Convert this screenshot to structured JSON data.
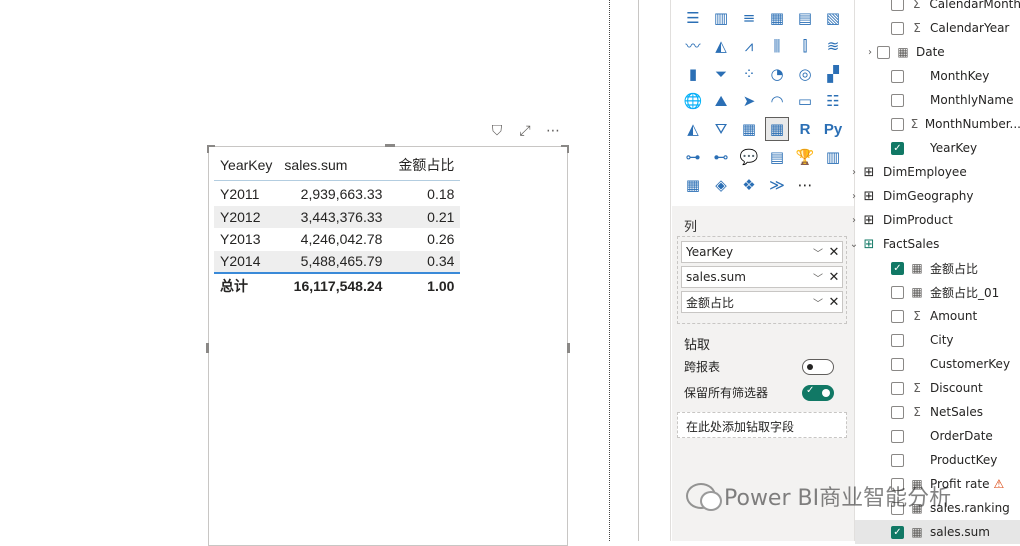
{
  "visual": {
    "header_icons": [
      "filter-icon",
      "focus-mode-icon",
      "more-options-icon"
    ],
    "header_glyphs": {
      "filter": "⛉",
      "focus": "⤢",
      "more": "⋯"
    },
    "table": {
      "headers": [
        "YearKey",
        "sales.sum",
        "金额占比"
      ],
      "rows": [
        [
          "Y2011",
          "2,939,663.33",
          "0.18"
        ],
        [
          "Y2012",
          "3,443,376.33",
          "0.21"
        ],
        [
          "Y2013",
          "4,246,042.78",
          "0.26"
        ],
        [
          "Y2014",
          "5,488,465.79",
          "0.34"
        ]
      ],
      "total": [
        "总计",
        "16,117,548.24",
        "1.00"
      ]
    }
  },
  "viz_pane": {
    "grid_icons": [
      {
        "name": "stacked-bar-chart-icon",
        "glyph": "☰"
      },
      {
        "name": "stacked-column-chart-icon",
        "glyph": "▥"
      },
      {
        "name": "clustered-bar-chart-icon",
        "glyph": "≡"
      },
      {
        "name": "clustered-column-chart-icon",
        "glyph": "▦"
      },
      {
        "name": "100-stacked-bar-chart-icon",
        "glyph": "▤"
      },
      {
        "name": "100-stacked-column-chart-icon",
        "glyph": "▧"
      },
      {
        "name": "line-chart-icon",
        "glyph": "〰"
      },
      {
        "name": "area-chart-icon",
        "glyph": "◭"
      },
      {
        "name": "stacked-area-chart-icon",
        "glyph": "⩘"
      },
      {
        "name": "line-and-column-chart-icon",
        "glyph": "⫼"
      },
      {
        "name": "line-and-clustered-column-icon",
        "glyph": "⫿"
      },
      {
        "name": "ribbon-chart-icon",
        "glyph": "≋"
      },
      {
        "name": "waterfall-chart-icon",
        "glyph": "▮"
      },
      {
        "name": "funnel-chart-icon",
        "glyph": "⏷"
      },
      {
        "name": "scatter-chart-icon",
        "glyph": "⁘"
      },
      {
        "name": "pie-chart-icon",
        "glyph": "◔"
      },
      {
        "name": "donut-chart-icon",
        "glyph": "◎"
      },
      {
        "name": "treemap-icon",
        "glyph": "▞"
      },
      {
        "name": "map-icon",
        "glyph": "🌐"
      },
      {
        "name": "filled-map-icon",
        "glyph": "⛰"
      },
      {
        "name": "azure-map-icon",
        "glyph": "➤"
      },
      {
        "name": "gauge-icon",
        "glyph": "◠"
      },
      {
        "name": "card-icon",
        "glyph": "▭"
      },
      {
        "name": "multi-row-card-icon",
        "glyph": "☷"
      },
      {
        "name": "kpi-icon",
        "glyph": "◭"
      },
      {
        "name": "slicer-icon",
        "glyph": "⛛"
      },
      {
        "name": "table-visual-icon",
        "glyph": "▦"
      },
      {
        "name": "matrix-visual-icon",
        "glyph": "▦"
      },
      {
        "name": "r-script-visual-icon",
        "glyph": "R"
      },
      {
        "name": "python-visual-icon",
        "glyph": "Py"
      },
      {
        "name": "key-influencers-icon",
        "glyph": "⊶"
      },
      {
        "name": "decomposition-tree-icon",
        "glyph": "⊷"
      },
      {
        "name": "qna-icon",
        "glyph": "💬"
      },
      {
        "name": "smart-narrative-icon",
        "glyph": "▤"
      },
      {
        "name": "goals-icon",
        "glyph": "🏆"
      },
      {
        "name": "paginated-report-icon",
        "glyph": "▥"
      },
      {
        "name": "custom-visual-1-icon",
        "glyph": "▦"
      },
      {
        "name": "custom-visual-2-icon",
        "glyph": "◈"
      },
      {
        "name": "custom-visual-3-icon",
        "glyph": "❖"
      },
      {
        "name": "custom-visual-4-icon",
        "glyph": "≫"
      },
      {
        "name": "get-more-visuals-icon",
        "glyph": "⋯"
      }
    ],
    "selected_visual_index": 27,
    "columns_label": "列",
    "wells": [
      "YearKey",
      "sales.sum",
      "金额占比"
    ],
    "drill_title": "钻取",
    "cross_report_label": "跨报表",
    "keep_filters_label": "保留所有筛选器",
    "drill_drop_label": "在此处添加钻取字段"
  },
  "fields_pane": {
    "items": [
      {
        "label": "CalendarMonth",
        "type": "sigma",
        "checked": false,
        "indent": 2
      },
      {
        "label": "CalendarYear",
        "type": "sigma",
        "checked": false,
        "indent": 2
      },
      {
        "label": "Date",
        "type": "calendar",
        "checked": false,
        "indent": 1,
        "expand": "›"
      },
      {
        "label": "MonthKey",
        "type": "none",
        "checked": false,
        "indent": 2
      },
      {
        "label": "MonthlyName",
        "type": "none",
        "checked": false,
        "indent": 2
      },
      {
        "label": "MonthNumber...",
        "type": "sigma",
        "checked": false,
        "indent": 2
      },
      {
        "label": "YearKey",
        "type": "none",
        "checked": true,
        "indent": 2
      },
      {
        "label": "DimEmployee",
        "type": "table",
        "indent": 0,
        "expand": "›"
      },
      {
        "label": "DimGeography",
        "type": "table",
        "indent": 0,
        "expand": "›"
      },
      {
        "label": "DimProduct",
        "type": "table",
        "indent": 0,
        "expand": "›"
      },
      {
        "label": "FactSales",
        "type": "table-active",
        "indent": 0,
        "expand": "⌄"
      },
      {
        "label": "金额占比",
        "type": "calc",
        "checked": true,
        "indent": 2
      },
      {
        "label": "金额占比_01",
        "type": "calc",
        "checked": false,
        "indent": 2
      },
      {
        "label": "Amount",
        "type": "sigma",
        "checked": false,
        "indent": 2
      },
      {
        "label": "City",
        "type": "none",
        "checked": false,
        "indent": 2
      },
      {
        "label": "CustomerKey",
        "type": "none",
        "checked": false,
        "indent": 2
      },
      {
        "label": "Discount",
        "type": "sigma",
        "checked": false,
        "indent": 2
      },
      {
        "label": "NetSales",
        "type": "sigma",
        "checked": false,
        "indent": 2
      },
      {
        "label": "OrderDate",
        "type": "none",
        "checked": false,
        "indent": 2
      },
      {
        "label": "ProductKey",
        "type": "none",
        "checked": false,
        "indent": 2
      },
      {
        "label": "Profit rate",
        "type": "calc",
        "checked": false,
        "indent": 2,
        "warning": true
      },
      {
        "label": "sales.ranking",
        "type": "calc",
        "checked": false,
        "indent": 2
      },
      {
        "label": "sales.sum",
        "type": "calc",
        "checked": true,
        "indent": 2,
        "selected": true
      }
    ]
  },
  "watermark": "Power BI商业智能分析",
  "colors": {
    "accent": "#117865",
    "icon_blue": "#2b6fb5",
    "warning": "#d83b01"
  }
}
